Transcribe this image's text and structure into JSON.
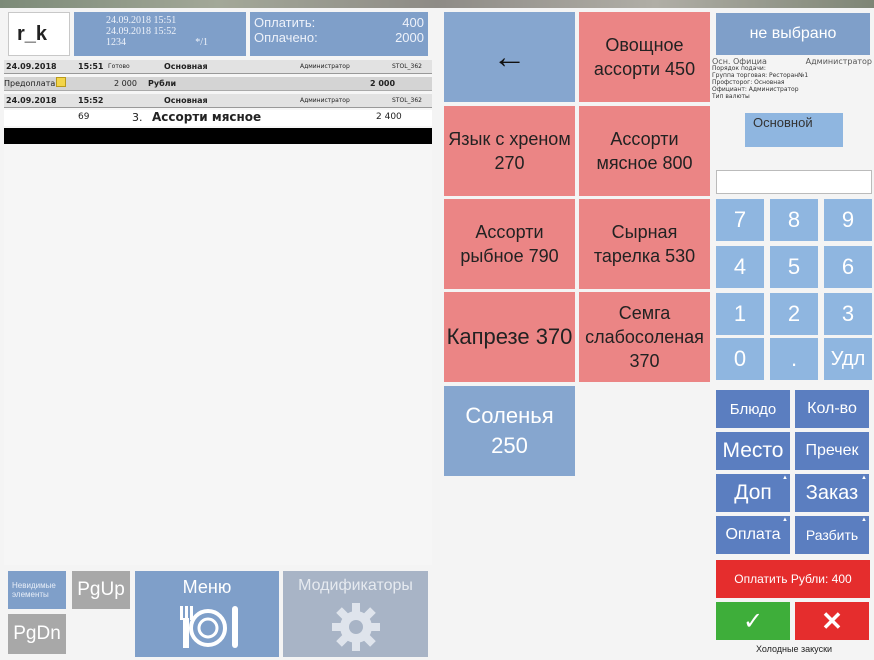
{
  "header": {
    "station": "r_k",
    "date_open": "24.09.2018 15:51",
    "date_now": "24.09.2018 15:52",
    "code": "1234",
    "guests": "*/1",
    "to_pay_label": "Оплатить:",
    "to_pay_value": "400",
    "paid_label": "Оплачено:",
    "paid_value": "2000"
  },
  "order": {
    "row1": {
      "date": "24.09.2018",
      "time": "15:51",
      "status": "Готово",
      "type": "Основная",
      "role": "Администратор",
      "table": "STOL_362"
    },
    "row2": {
      "label": "Предоплата",
      "amount": "2 000",
      "currency": "Рубли",
      "total": "2 000"
    },
    "row3": {
      "date": "24.09.2018",
      "time": "15:52",
      "type": "Основная",
      "role": "Администратор",
      "table": "STOL_362"
    },
    "row4": {
      "code": "69",
      "qty": "3.",
      "name": "Ассорти мясное",
      "price": "2 400"
    }
  },
  "bottom_left": {
    "invisible_label": "Невидимые элементы",
    "pgup": "PgUp",
    "pgdn": "PgDn",
    "menu": "Меню",
    "modifiers": "Модификаторы"
  },
  "dishes": {
    "back_arrow": "←",
    "d1": "Овощное ассорти 450",
    "d2": "Язык с хреном 270",
    "d3": "Ассорти мясное 800",
    "d4": "Ассорти рыбное 790",
    "d5": "Сырная тарелка 530",
    "d6": "Капрезе 370",
    "d7": "Семга слабосоленая 370",
    "d8": "Соленья 250"
  },
  "right": {
    "not_chosen": "не выбрано",
    "info_waiter": "Осн. Официа",
    "info_admin": "Администратор",
    "info_line2": "Порядок подачи:",
    "info_line3": "Группа торговая: Ресторан№1",
    "info_line4": "Профсторог: Основная",
    "info_line5": "Официант: Администратор",
    "info_line6": "Тип валюты",
    "osn": "Основной",
    "keys": [
      "7",
      "8",
      "9",
      "4",
      "5",
      "6",
      "1",
      "2",
      "3",
      "0",
      ".",
      "Удл"
    ],
    "dish_btn": "Блюдо",
    "qty_btn": "Кол-во",
    "place_btn": "Место",
    "precheck_btn": "Пречек",
    "add_btn": "Доп",
    "order_btn": "Заказ",
    "payment_btn": "Оплата",
    "split_btn": "Разбить",
    "pay_rub": "Оплатить Рубли: 400",
    "ok": "✓",
    "cancel": "✕",
    "category": "Холодные закуски"
  },
  "colors": {
    "blue": "#7f9fc9",
    "red_dish": "#eb8585",
    "keypad": "#8fb6e0",
    "action": "#5b7ec0",
    "danger": "#e52d2d",
    "success": "#3eae3a"
  }
}
